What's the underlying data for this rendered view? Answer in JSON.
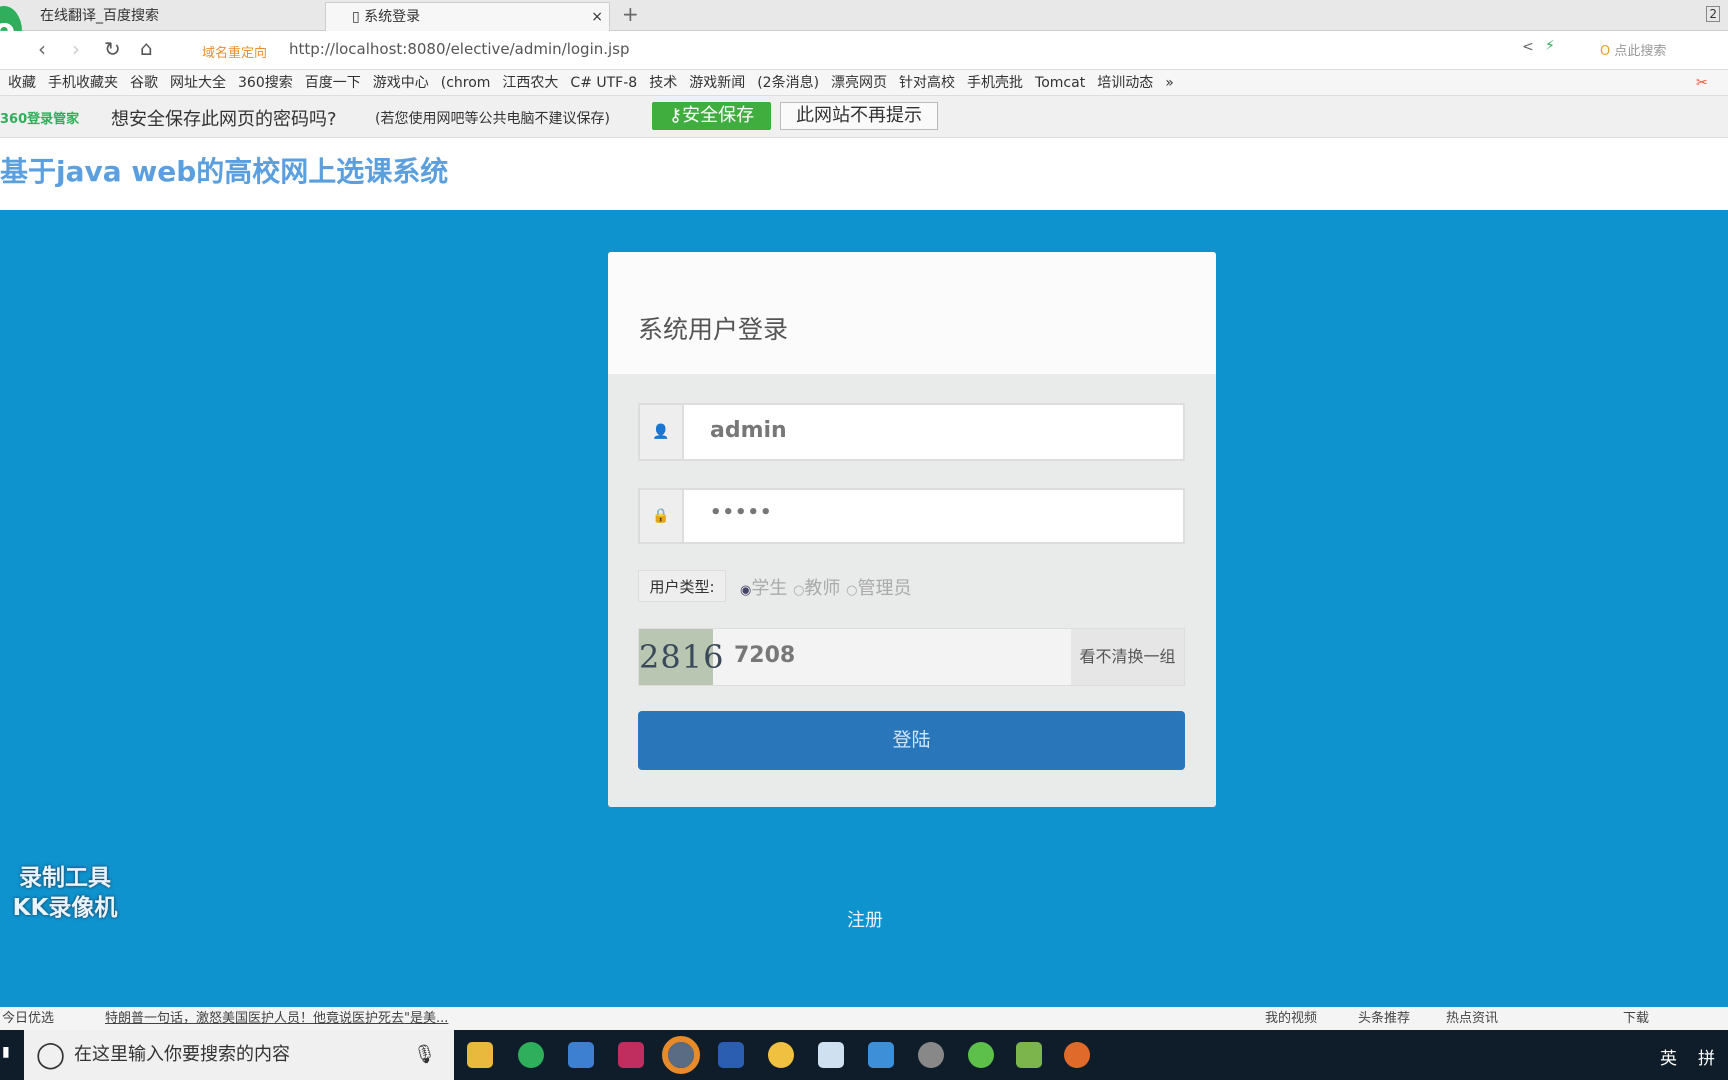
{
  "browser": {
    "tabs": [
      {
        "label": "在线翻译_百度搜索"
      },
      {
        "label": "系统登录",
        "close": "×"
      }
    ],
    "new_tab": "+",
    "tab_count": "2",
    "redirect_label": "域名重定向",
    "url": "http://localhost:8080/elective/admin/login.jsp",
    "search_placeholder": "点此搜索",
    "bookmarks": [
      "收藏",
      "手机收藏夹",
      "谷歌",
      "网址大全",
      "360搜索",
      "百度一下",
      "游戏中心",
      "(chrom",
      "江西农大",
      "C# UTF-8",
      "技术",
      "游戏新闻",
      "(2条消息)",
      "漂亮网页",
      "针对高校",
      "手机壳批",
      "Tomcat",
      "培训动态",
      "»"
    ]
  },
  "password_bar": {
    "brand": "360登录管家",
    "question": "想安全保存此网页的密码吗?",
    "note": "(若您使用网吧等公共电脑不建议保存)",
    "save": "安全保存",
    "never": "此网站不再提示"
  },
  "page": {
    "site_title": "基于java web的高校网上选课系统",
    "card_title": "系统用户登录",
    "username": "admin",
    "password": "•••••",
    "user_type_label": "用户类型:",
    "user_types": [
      {
        "label": "学生",
        "checked": true
      },
      {
        "label": "教师",
        "checked": false
      },
      {
        "label": "管理员",
        "checked": false
      }
    ],
    "captcha_image_text": "2816",
    "captcha_value": "7208",
    "captcha_refresh": "看不清换一组",
    "login_button": "登陆",
    "register_link": "注册",
    "watermark": [
      "录制工具",
      "KK录像机"
    ]
  },
  "status_bar": {
    "left": "今日优选",
    "news": "特朗普一句话，激怒美国医护人员！他竟说医护死去\"是美...",
    "items": [
      "我的视频",
      "头条推荐",
      "热点资讯",
      "下载"
    ]
  },
  "taskbar": {
    "search_placeholder": "在这里输入你要搜索的内容",
    "tray": [
      "英",
      "拼"
    ]
  }
}
